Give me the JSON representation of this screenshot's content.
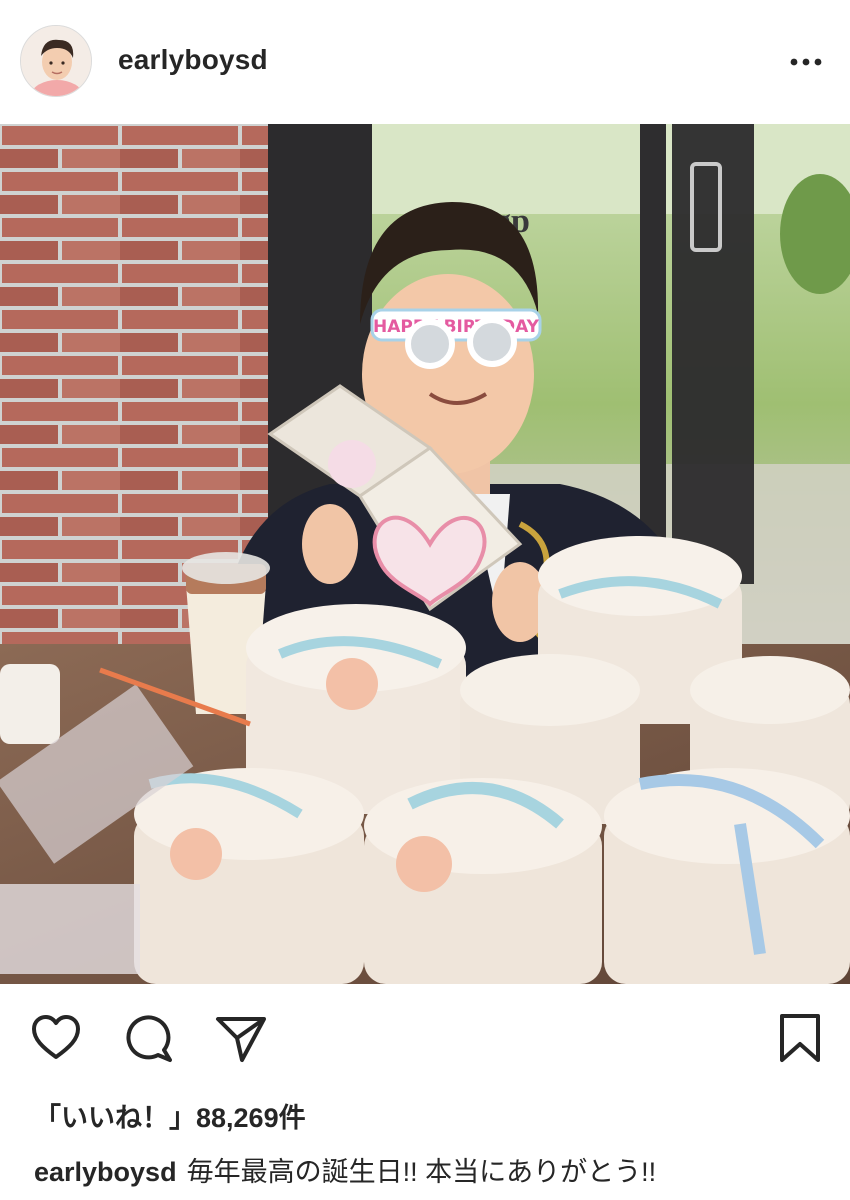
{
  "post": {
    "username": "earlyboysd",
    "more_icon": "more-horizontal-icon",
    "photo_text": {
      "glasses": "HAPPY BIRTHDAY",
      "window_lettering": "gp"
    }
  },
  "actions": {
    "like_icon": "heart-icon",
    "comment_icon": "comment-bubble-icon",
    "share_icon": "paper-plane-icon",
    "save_icon": "bookmark-icon"
  },
  "likes": {
    "text": "「いいね！」88,269件"
  },
  "caption": {
    "username": "earlyboysd",
    "text": "毎年最高の誕生日!! 本当にありがとう!!"
  },
  "colors": {
    "text": "#262626",
    "border": "#dbdbdb",
    "background": "#ffffff"
  }
}
